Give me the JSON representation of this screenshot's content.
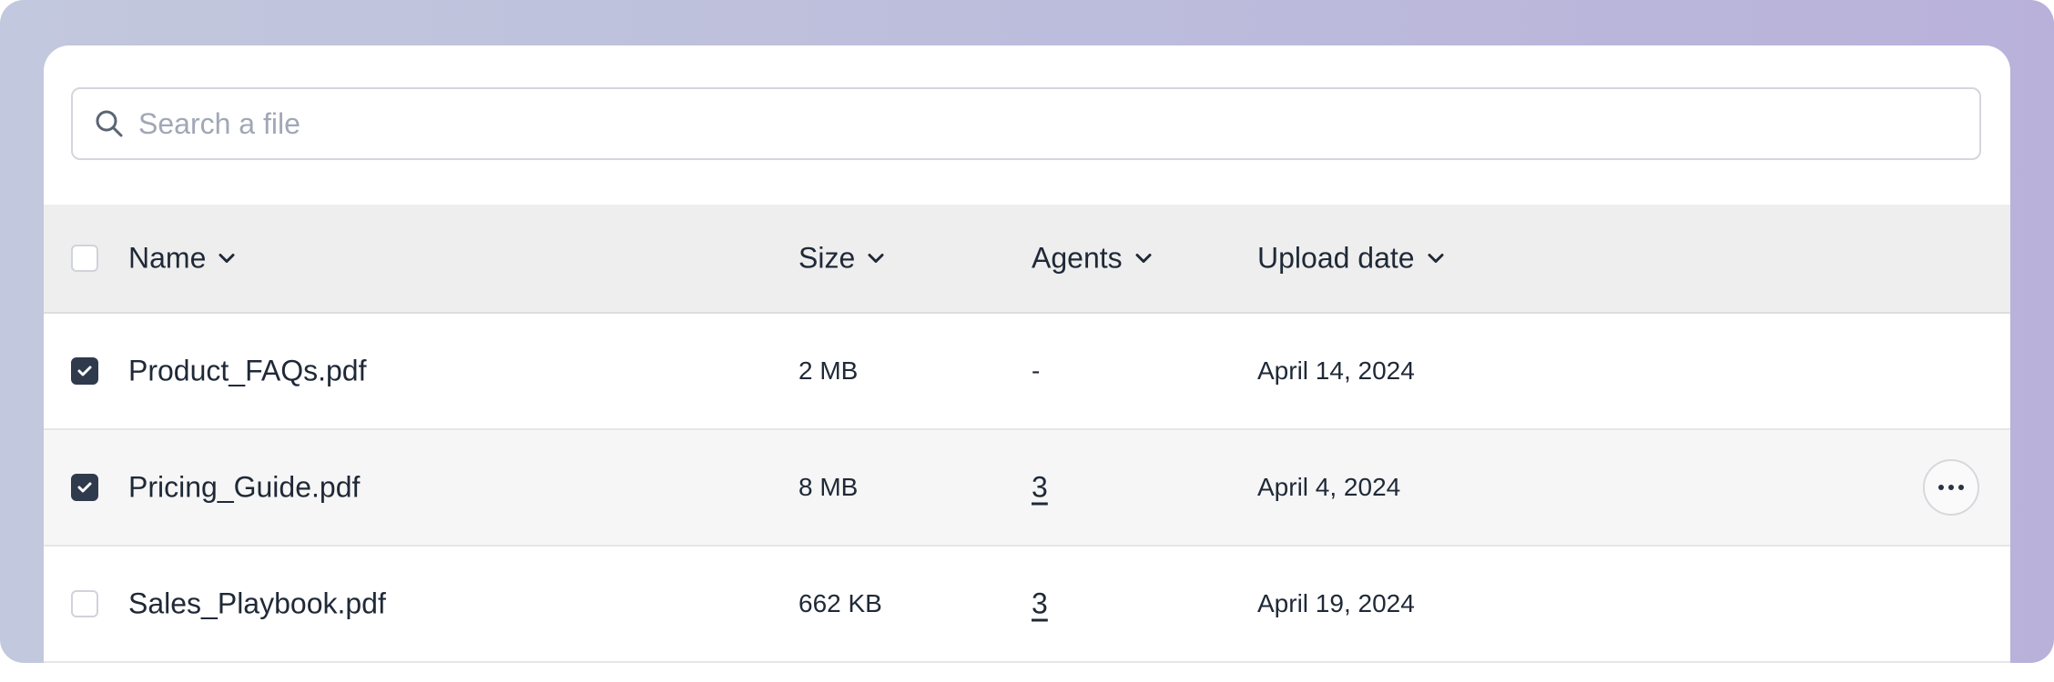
{
  "search": {
    "placeholder": "Search a file",
    "icon": "search-icon"
  },
  "table": {
    "columns": [
      {
        "label": "Name",
        "sortable": true
      },
      {
        "label": "Size",
        "sortable": true
      },
      {
        "label": "Agents",
        "sortable": true
      },
      {
        "label": "Upload date",
        "sortable": true
      }
    ],
    "rows": [
      {
        "name": "Product_FAQs.pdf",
        "size": "2 MB",
        "agents": "-",
        "agents_link": false,
        "date": "April 14, 2024",
        "checked": true
      },
      {
        "name": "Pricing_Guide.pdf",
        "size": "8 MB",
        "agents": "3",
        "agents_link": true,
        "date": "April 4, 2024",
        "checked": true,
        "hovered": true
      },
      {
        "name": "Sales_Playbook.pdf",
        "size": "662 KB",
        "agents": "3",
        "agents_link": true,
        "date": "April 19, 2024",
        "checked": false
      }
    ]
  },
  "colors": {
    "checked": "#2f3a4d",
    "header_bg": "#eeeeee",
    "hover_row_bg": "#f6f6f6",
    "text": "#1f2937",
    "placeholder": "#a0a8b6"
  }
}
